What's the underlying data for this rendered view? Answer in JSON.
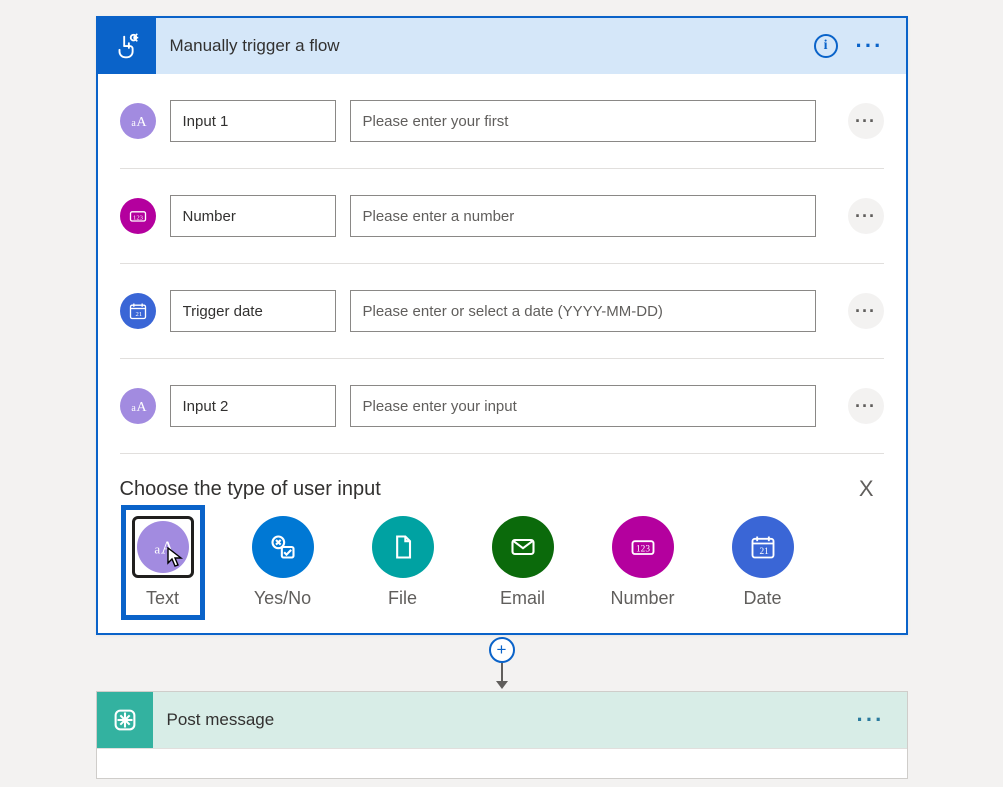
{
  "trigger": {
    "title": "Manually trigger a flow",
    "inputs": [
      {
        "name": "Input 1",
        "placeholder": "Please enter your first",
        "iconClass": "icon-text",
        "icon": "text"
      },
      {
        "name": "Number",
        "placeholder": "Please enter a number",
        "iconClass": "icon-number",
        "icon": "number"
      },
      {
        "name": "Trigger date",
        "placeholder": "Please enter or select a date (YYYY-MM-DD)",
        "iconClass": "icon-date",
        "icon": "date"
      },
      {
        "name": "Input 2",
        "placeholder": "Please enter your input",
        "iconClass": "icon-text",
        "icon": "text"
      }
    ]
  },
  "chooser": {
    "title": "Choose the type of user input",
    "close": "X",
    "selected": "text",
    "options": [
      {
        "key": "text",
        "label": "Text",
        "iconClass": "icon-text"
      },
      {
        "key": "yesno",
        "label": "Yes/No",
        "iconClass": "icon-yesno"
      },
      {
        "key": "file",
        "label": "File",
        "iconClass": "icon-file"
      },
      {
        "key": "email",
        "label": "Email",
        "iconClass": "icon-email"
      },
      {
        "key": "number",
        "label": "Number",
        "iconClass": "icon-number"
      },
      {
        "key": "date",
        "label": "Date",
        "iconClass": "icon-date"
      }
    ]
  },
  "action": {
    "title": "Post message"
  },
  "glyphs": {
    "info": "i",
    "ellipsis": "···",
    "plus": "+"
  }
}
